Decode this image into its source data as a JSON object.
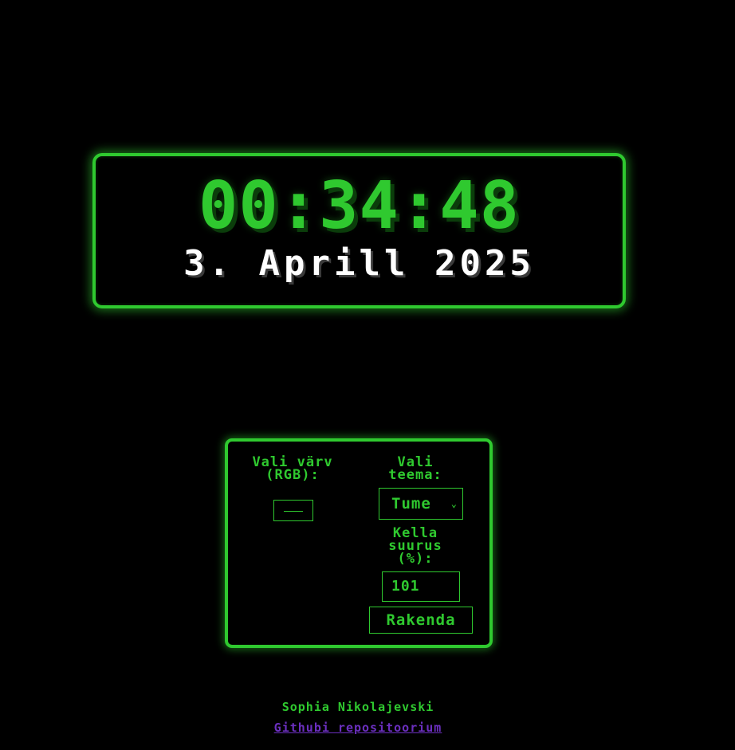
{
  "clock": {
    "time": "00:34:48",
    "date": "3. Aprill 2025"
  },
  "settings": {
    "color_label": "Vali värv (RGB):",
    "color_value": "#2fc92f",
    "theme_label": "Vali teema:",
    "theme_selected": "Tume",
    "size_label": "Kella suurus (%):",
    "size_value": "101",
    "apply_label": "Rakenda"
  },
  "footer": {
    "author": "Sophia Nikolajevski",
    "repo_link": "Githubi repositoorium"
  },
  "colors": {
    "accent": "#2fc92f",
    "background": "#000000",
    "link": "#6b2fbf",
    "date_text": "#ffffff"
  }
}
